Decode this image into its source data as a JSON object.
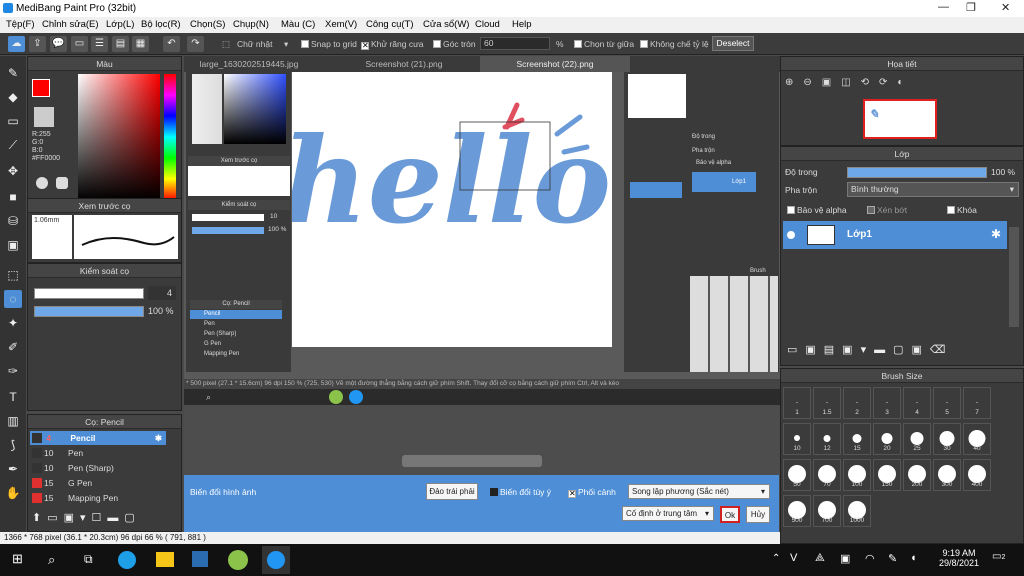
{
  "window": {
    "title": "MediBang Paint Pro (32bit)",
    "minimize": "—",
    "restore": "❐",
    "close": "✕"
  },
  "menu": [
    "Tệp(F)",
    "Chỉnh sửa(E)",
    "Lớp(L)",
    "Bộ lọc(R)",
    "Chọn(S)",
    "Chụp(N)",
    "Màu (C)",
    "Xem(V)",
    "Công cụ(T)",
    "Cửa sổ(W)",
    "Cloud",
    "Help"
  ],
  "toolbar": {
    "shape": "Chữ nhật",
    "snap": "Snap to grid",
    "antialias": "Khử răng cưa",
    "round": "Góc tròn",
    "round_value": "60",
    "percent": "%",
    "center": "Chọn từ giữa",
    "ratio": "Không chế tỷ lệ",
    "deselect": "Deselect"
  },
  "tabs": [
    "large_1630202519445.jpg",
    "Screenshot (21).png",
    "Screenshot (22).png"
  ],
  "color_panel": {
    "title": "Màu",
    "r": "R:255",
    "g": "G:0",
    "b": "B:0",
    "hex": "#FF0000",
    "primary_color": "#ff0000"
  },
  "brush_preview": {
    "title": "Xem trước cọ",
    "size": "1.06mm"
  },
  "brush_control": {
    "title": "Kiểm soát cọ",
    "size": "4",
    "opacity": "100 %"
  },
  "brush_list": {
    "title": "Cọ: Pencil",
    "items": [
      {
        "size": "4",
        "name": "Pencil",
        "color": "#3a3a3a",
        "active": true
      },
      {
        "size": "10",
        "name": "Pen",
        "color": "#3a3a3a"
      },
      {
        "size": "10",
        "name": "Pen (Sharp)",
        "color": "#3a3a3a"
      },
      {
        "size": "15",
        "name": "G Pen",
        "color": "#e03030"
      },
      {
        "size": "15",
        "name": "Mapping Pen",
        "color": "#e03030"
      }
    ]
  },
  "inner": {
    "brush_preview": "Xem trước cọ",
    "brush_control": "Kiểm soát cọ",
    "size": "10",
    "opacity": "100 %",
    "brush_list": "Cọ: Pencil",
    "items": [
      "Pencil",
      "Pen",
      "Pen (Sharp)",
      "G Pen",
      "Mapping Pen"
    ],
    "opacity_label": "Độ trong",
    "blend": "Pha trộn",
    "protect": "Bảo vệ alpha",
    "layer": "Lớp1",
    "brush": "Brush"
  },
  "canvas_text": "hello",
  "statusline": "* 500 pixel (27.1 * 15.6cm) 96 dpi 150 % (725, 530) Vẽ một đường thẳng bằng cách giữ phím Shift. Thay đổi cỡ cọ bằng cách giữ phím Ctrl, Alt và kéo",
  "transform_bar": {
    "label": "Biến đổi hình ảnh",
    "flip": "Đảo trái phải",
    "free": "Biến đổi tùy ý",
    "blend": "Phối cảnh",
    "interp": "Song lập phương (Sắc nét)",
    "fixed": "Cố định ở trung tâm",
    "ok": "Ok",
    "cancel": "Hủy"
  },
  "status": "1366 * 768 pixel   (36.1 * 20.3cm)   96 dpi   66 %   ( 791, 881 )",
  "navigator": {
    "title": "Họa tiết"
  },
  "layer_panel": {
    "title": "Lớp",
    "opacity_label": "Độ trong",
    "opacity": "100 %",
    "blend_label": "Pha trộn",
    "blend": "Bình thường",
    "protect": "Bảo vệ alpha",
    "clip": "Xén bớt",
    "lock": "Khóa",
    "layer_name": "Lớp1"
  },
  "brush_size": {
    "title": "Brush Size",
    "sizes": [
      "1",
      "1.5",
      "2",
      "3",
      "4",
      "5",
      "7",
      "10",
      "12",
      "15",
      "20",
      "25",
      "30",
      "40",
      "50",
      "70",
      "100",
      "150",
      "200",
      "300",
      "400",
      "500",
      "700",
      "1000"
    ]
  },
  "taskbar": {
    "time": "9:19 AM",
    "date": "29/8/2021",
    "notif": "2"
  }
}
